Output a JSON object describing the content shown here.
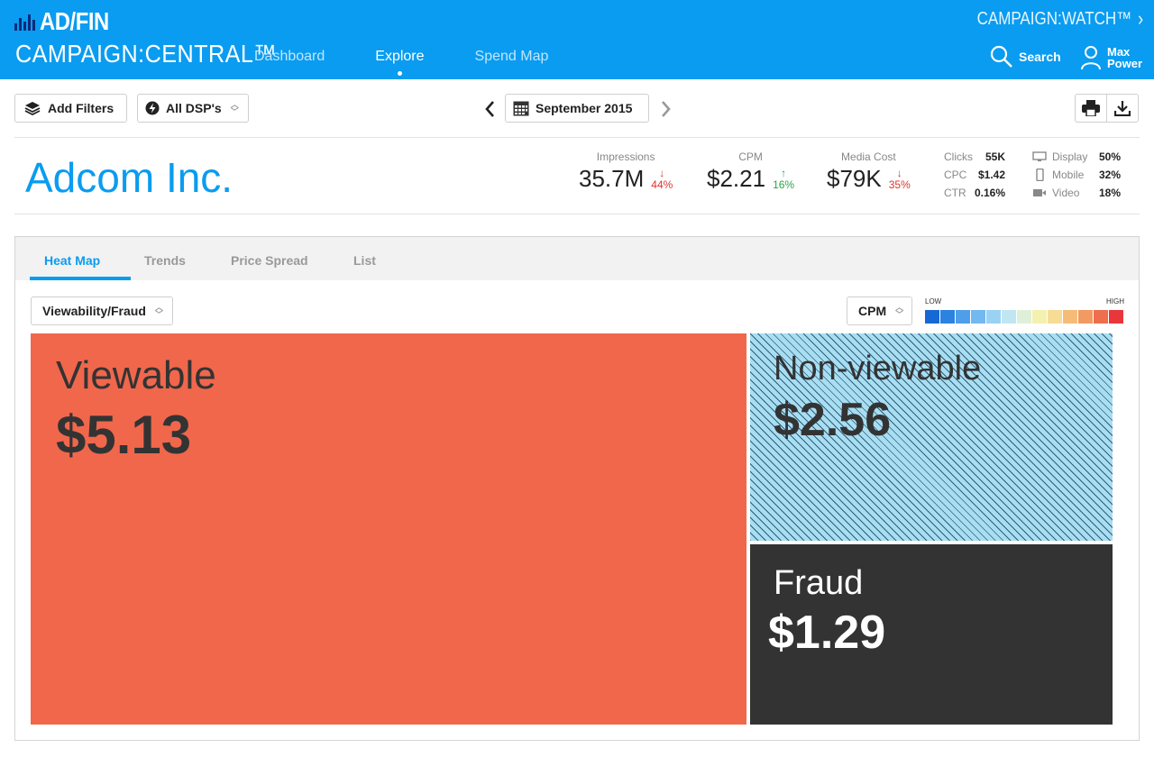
{
  "header": {
    "logo": "AD/FIN",
    "product": "CAMPAIGN:CENTRAL™",
    "nav": [
      "Dashboard",
      "Explore",
      "Spend Map"
    ],
    "active_nav": "Explore",
    "campaign_watch": "CAMPAIGN:WATCH™",
    "search_label": "Search",
    "user_first": "Max",
    "user_last": "Power"
  },
  "toolbar": {
    "add_filters": "Add Filters",
    "dsp": "All DSP's",
    "month": "September 2015"
  },
  "company": "Adcom Inc.",
  "stats": [
    {
      "label": "Impressions",
      "value": "35.7M",
      "change": "44%",
      "direction": "down"
    },
    {
      "label": "CPM",
      "value": "$2.21",
      "change": "16%",
      "direction": "up"
    },
    {
      "label": "Media Cost",
      "value": "$79K",
      "change": "35%",
      "direction": "down"
    }
  ],
  "metrics": [
    {
      "label": "Clicks",
      "value": "55K"
    },
    {
      "label": "CPC",
      "value": "$1.42"
    },
    {
      "label": "CTR",
      "value": "0.16%"
    }
  ],
  "devices": [
    {
      "label": "Display",
      "value": "50%",
      "icon": "monitor-icon"
    },
    {
      "label": "Mobile",
      "value": "32%",
      "icon": "mobile-icon"
    },
    {
      "label": "Video",
      "value": "18%",
      "icon": "video-icon"
    }
  ],
  "panel": {
    "tabs": [
      "Heat Map",
      "Trends",
      "Price Spread",
      "List"
    ],
    "active_tab": "Heat Map",
    "dimension": "Viewability/Fraud",
    "metric": "CPM",
    "legend_low": "LOW",
    "legend_high": "HIGH",
    "legend_colors": [
      "#1668d4",
      "#2b82e0",
      "#4e9eea",
      "#73b8f0",
      "#9ad2f4",
      "#c0e6f2",
      "#dff0d8",
      "#f4f0b0",
      "#f7dc95",
      "#f5bc78",
      "#f39a62",
      "#ee6e4e",
      "#e8363a"
    ]
  },
  "heatmap": [
    {
      "name": "Viewable",
      "value": "$5.13",
      "color": "#f0674c"
    },
    {
      "name": "Non-viewable",
      "value": "$2.56",
      "color": "#a8def2"
    },
    {
      "name": "Fraud",
      "value": "$1.29",
      "color": "#333333"
    }
  ]
}
